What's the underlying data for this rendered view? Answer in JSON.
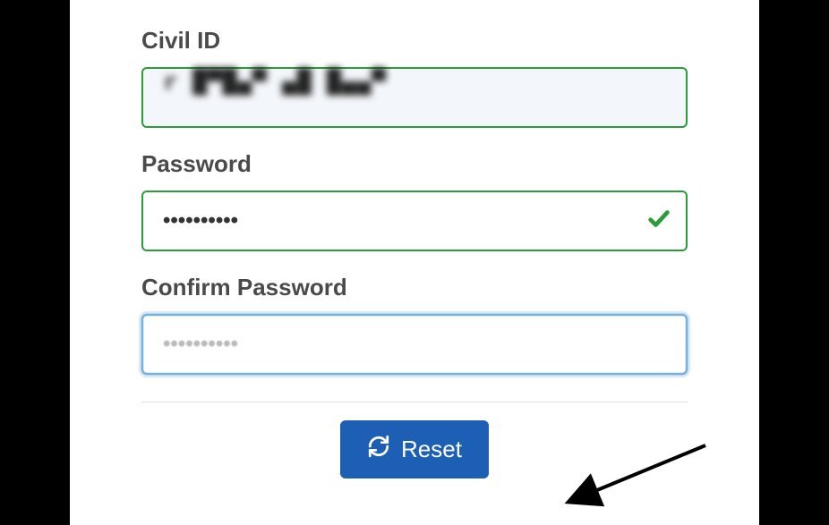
{
  "form": {
    "civil_id": {
      "label": "Civil ID",
      "value": "██████████"
    },
    "password": {
      "label": "Password",
      "value": "••••••••••",
      "validated": true
    },
    "confirm_password": {
      "label": "Confirm Password",
      "value": "••••••••••"
    },
    "reset_button_label": "Reset"
  },
  "colors": {
    "valid_border": "#2b9c3a",
    "focus_border": "#5a9ed6",
    "primary_button": "#1d5fb5"
  }
}
